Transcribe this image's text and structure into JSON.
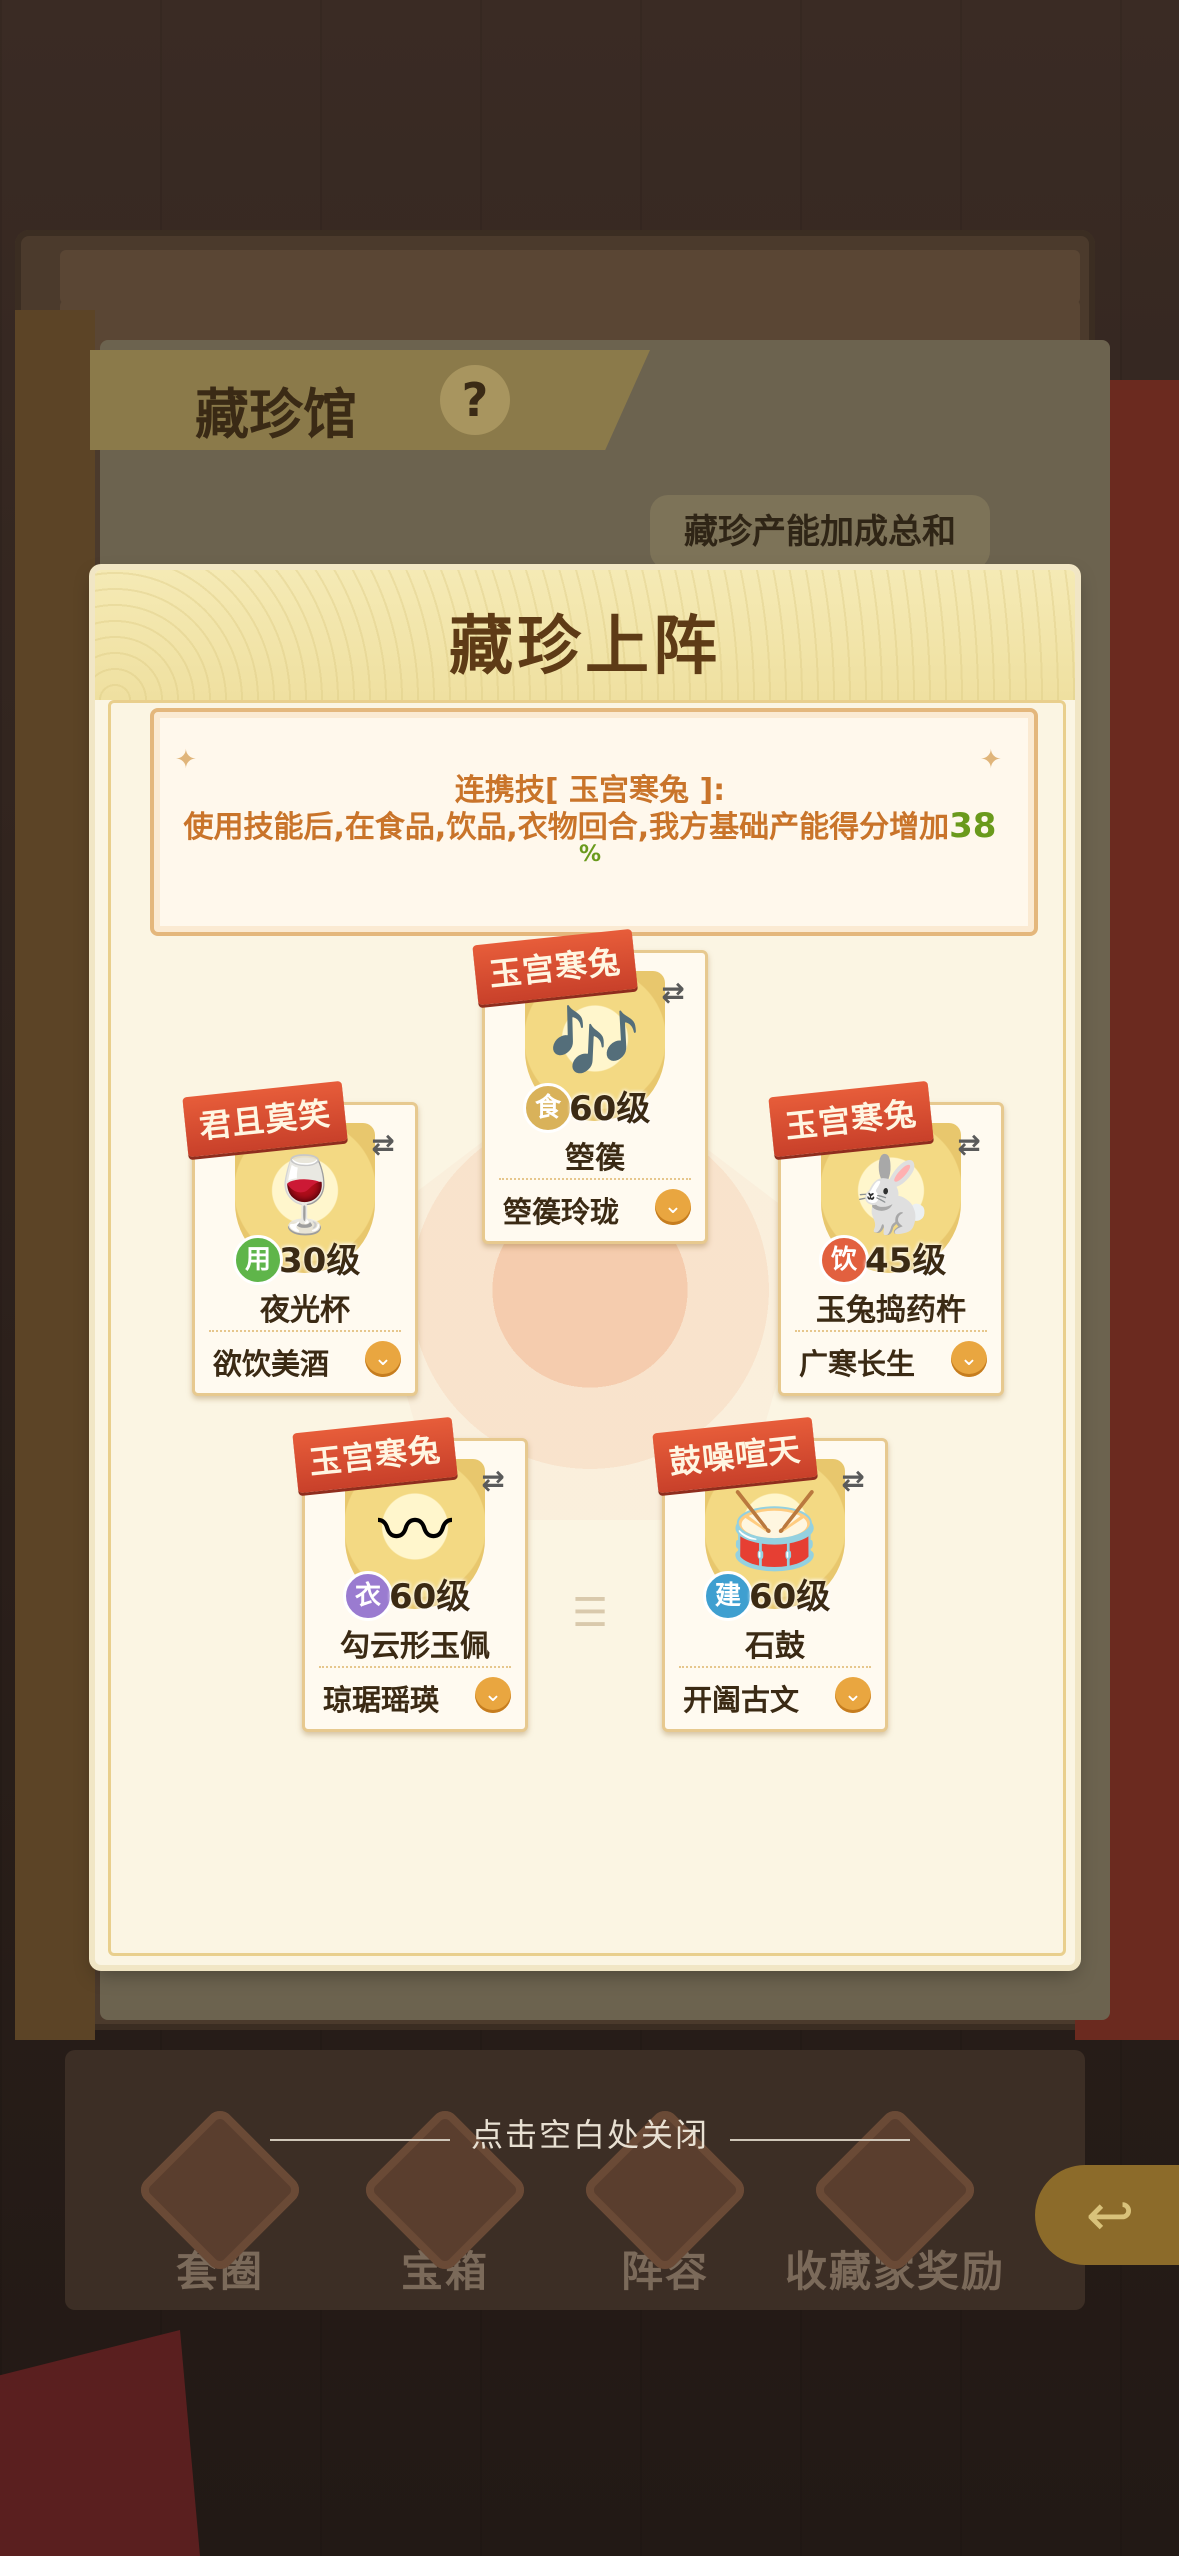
{
  "background": {
    "title": "藏珍馆",
    "help_icon": "?",
    "summary_label": "藏珍产能加成总和",
    "nav": [
      {
        "label": "套圈",
        "icon": "vase-icon"
      },
      {
        "label": "宝箱",
        "icon": "chest-icon"
      },
      {
        "label": "阵容",
        "icon": "bag-icon"
      },
      {
        "label": "收藏家奖励",
        "icon": "medal-icon"
      }
    ],
    "back_icon": "↩"
  },
  "modal": {
    "title": "藏珍上阵",
    "skill": {
      "line1": "连携技[ 玉宫寒兔 ]:",
      "line2": "使用技能后,在食品,饮品,衣物回合,我方基础产能得分增加",
      "bonus_value": "38",
      "bonus_unit": "%"
    },
    "cards": [
      {
        "id": "top",
        "tag": "玉宫寒兔",
        "type_char": "食",
        "type_color": "#d9b25a",
        "level": "60级",
        "name": "箜篌",
        "set": "箜篌玲珑",
        "icon": "🎶"
      },
      {
        "id": "left",
        "tag": "君且莫笑",
        "type_char": "用",
        "type_color": "#5fb54a",
        "level": "30级",
        "name": "夜光杯",
        "set": "欲饮美酒",
        "icon": "🍷"
      },
      {
        "id": "right",
        "tag": "玉宫寒兔",
        "type_char": "饮",
        "type_color": "#e2603f",
        "level": "45级",
        "name": "玉兔捣药杵",
        "set": "广寒长生",
        "icon": "🐇"
      },
      {
        "id": "bottom-left",
        "tag": "玉宫寒兔",
        "type_char": "衣",
        "type_color": "#9a7bd0",
        "level": "60级",
        "name": "勾云形玉佩",
        "set": "琼琚瑶瑛",
        "icon": "〰"
      },
      {
        "id": "bottom-right",
        "tag": "鼓噪喧天",
        "type_char": "建",
        "type_color": "#3f9fd0",
        "level": "60级",
        "name": "石鼓",
        "set": "开阖古文",
        "icon": "🥁"
      }
    ],
    "swap_icon": "⇄",
    "dropdown_icon": "⌄"
  },
  "hint": "点击空白处关闭"
}
